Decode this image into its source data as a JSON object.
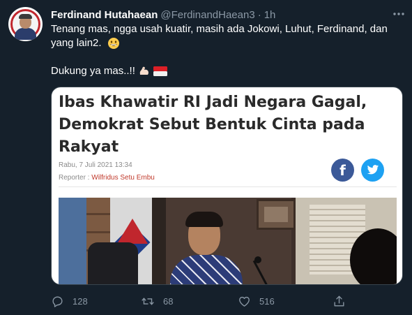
{
  "author": {
    "display_name": "Ferdinand Hutahaean",
    "handle": "@FerdinandHaean3",
    "separator": "·",
    "time": "1h"
  },
  "tweet": {
    "line1": "Tenang mas, ngga usah kuatir, masih ada Jokowi, Luhut, Ferdinand, dan",
    "line2": "yang lain2.",
    "line2_emoji": "grinning-face-emoji",
    "para2": "Dukung ya mas..!!",
    "para2_emojis": [
      "flexed-biceps-emoji",
      "indonesia-flag-emoji"
    ]
  },
  "card": {
    "headline": "Ibas Khawatir RI Jadi Negara Gagal, Demokrat Sebut Bentuk Cinta pada Rakyat",
    "date": "Rabu, 7 Juli 2021 13:34",
    "reporter_label": "Reporter : ",
    "reporter_name": "Wilfridus Setu Embu",
    "share_icons": [
      "facebook-icon",
      "twitter-icon"
    ],
    "colors": {
      "facebook": "#3b5998",
      "twitter": "#1da1f2",
      "reporter": "#c0392b"
    }
  },
  "actions": {
    "replies": "128",
    "retweets": "68",
    "likes": "516"
  },
  "theme": {
    "background": "#15202b",
    "muted": "#8b98a5",
    "text": "#ffffff"
  }
}
